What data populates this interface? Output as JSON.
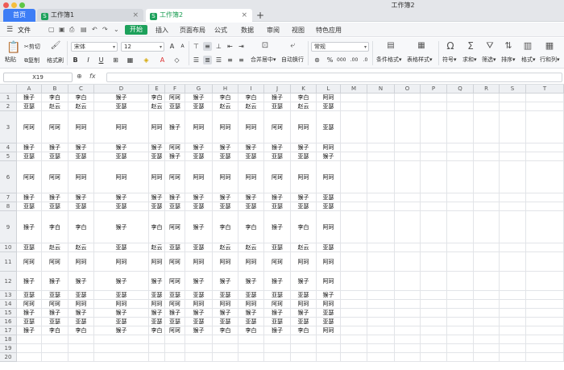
{
  "window": {
    "title": "工作簿2",
    "tabs": [
      {
        "label": "首页"
      },
      {
        "label": "工作簿1"
      },
      {
        "label": "工作簿2"
      }
    ],
    "new_tab": "+"
  },
  "menu": {
    "file": "文件",
    "start": "开始",
    "items": [
      "插入",
      "页面布局",
      "公式",
      "数据",
      "审阅",
      "视图",
      "特色应用"
    ]
  },
  "ribbon": {
    "paste": "粘贴",
    "cut": "剪切",
    "copy": "复制",
    "format_painter": "格式刷",
    "font": "宋体",
    "font_size": "12",
    "bold": "B",
    "italic": "I",
    "underline": "U",
    "merge": "合并居中",
    "wrap": "自动换行",
    "number_format": "常规",
    "cond_format": "条件格式",
    "table_style": "表格样式",
    "symbol": "符号",
    "sum": "求和",
    "filter": "筛选",
    "sort": "排序",
    "format": "格式",
    "rows_cols": "行和列"
  },
  "formula_bar": {
    "name_box": "X19",
    "fx": "fx",
    "value": ""
  },
  "sheet": {
    "columns": [
      "A",
      "B",
      "C",
      "D",
      "E",
      "F",
      "G",
      "H",
      "I",
      "J",
      "K",
      "L",
      "M",
      "N",
      "O",
      "P",
      "Q",
      "R",
      "S",
      "T"
    ],
    "row_numbers": [
      "1",
      "2",
      "3",
      "4",
      "5",
      "6",
      "7",
      "8",
      "9",
      "10",
      "11",
      "12",
      "13",
      "14",
      "15",
      "16",
      "17",
      "18",
      "19",
      "20"
    ],
    "rows": [
      [
        "猴子",
        "李白",
        "李白",
        "猴子",
        "李白",
        "阿珂",
        "猴子",
        "李白",
        "李白",
        "猴子",
        "李白",
        "阿珂"
      ],
      [
        "亚瑟",
        "赵云",
        "赵云",
        "亚瑟",
        "赵云",
        "亚瑟",
        "亚瑟",
        "赵云",
        "赵云",
        "亚瑟",
        "赵云",
        "亚瑟"
      ],
      [
        "阿珂",
        "阿珂",
        "阿珂",
        "阿珂",
        "阿珂",
        "猴子",
        "阿珂",
        "阿珂",
        "阿珂",
        "阿珂",
        "阿珂",
        "亚瑟"
      ],
      [
        "猴子",
        "猴子",
        "猴子",
        "猴子",
        "猴子",
        "阿珂",
        "猴子",
        "猴子",
        "猴子",
        "猴子",
        "猴子",
        "阿珂"
      ],
      [
        "亚瑟",
        "亚瑟",
        "亚瑟",
        "亚瑟",
        "亚瑟",
        "猴子",
        "亚瑟",
        "亚瑟",
        "亚瑟",
        "亚瑟",
        "亚瑟",
        "猴子"
      ],
      [
        "阿珂",
        "阿珂",
        "阿珂",
        "阿珂",
        "阿珂",
        "阿珂",
        "阿珂",
        "阿珂",
        "阿珂",
        "阿珂",
        "阿珂",
        "阿珂"
      ],
      [
        "猴子",
        "猴子",
        "猴子",
        "猴子",
        "猴子",
        "猴子",
        "猴子",
        "猴子",
        "猴子",
        "猴子",
        "猴子",
        "亚瑟"
      ],
      [
        "亚瑟",
        "亚瑟",
        "亚瑟",
        "亚瑟",
        "亚瑟",
        "亚瑟",
        "亚瑟",
        "亚瑟",
        "亚瑟",
        "亚瑟",
        "亚瑟",
        "亚瑟"
      ],
      [
        "猴子",
        "李白",
        "李白",
        "猴子",
        "李白",
        "阿珂",
        "猴子",
        "李白",
        "李白",
        "猴子",
        "李白",
        "阿珂"
      ],
      [
        "亚瑟",
        "赵云",
        "赵云",
        "亚瑟",
        "赵云",
        "亚瑟",
        "亚瑟",
        "赵云",
        "赵云",
        "亚瑟",
        "赵云",
        "亚瑟"
      ],
      [
        "阿珂",
        "阿珂",
        "阿珂",
        "阿珂",
        "阿珂",
        "阿珂",
        "阿珂",
        "阿珂",
        "阿珂",
        "阿珂",
        "阿珂",
        "阿珂"
      ],
      [
        "猴子",
        "猴子",
        "猴子",
        "猴子",
        "猴子",
        "阿珂",
        "猴子",
        "猴子",
        "猴子",
        "猴子",
        "猴子",
        "阿珂"
      ],
      [
        "亚瑟",
        "亚瑟",
        "亚瑟",
        "亚瑟",
        "亚瑟",
        "亚瑟",
        "亚瑟",
        "亚瑟",
        "亚瑟",
        "亚瑟",
        "亚瑟",
        "猴子"
      ],
      [
        "阿珂",
        "阿珂",
        "阿珂",
        "阿珂",
        "阿珂",
        "阿珂",
        "阿珂",
        "阿珂",
        "阿珂",
        "阿珂",
        "阿珂",
        "阿珂"
      ],
      [
        "猴子",
        "猴子",
        "猴子",
        "猴子",
        "猴子",
        "猴子",
        "猴子",
        "猴子",
        "猴子",
        "猴子",
        "猴子",
        "亚瑟"
      ],
      [
        "亚瑟",
        "亚瑟",
        "亚瑟",
        "亚瑟",
        "亚瑟",
        "亚瑟",
        "亚瑟",
        "亚瑟",
        "亚瑟",
        "亚瑟",
        "亚瑟",
        "亚瑟"
      ],
      [
        "猴子",
        "李白",
        "李白",
        "猴子",
        "李白",
        "阿珂",
        "猴子",
        "李白",
        "李白",
        "猴子",
        "李白",
        "阿珂"
      ],
      [
        "",
        "",
        "",
        "",
        "",
        "",
        "",
        "",
        "",
        "",
        "",
        ""
      ],
      [
        "",
        "",
        "",
        "",
        "",
        "",
        "",
        "",
        "",
        "",
        "",
        ""
      ],
      [
        "",
        "",
        "",
        "",
        "",
        "",
        "",
        "",
        "",
        "",
        "",
        ""
      ]
    ]
  },
  "colors": {
    "accent_green": "#1da15b",
    "home_tab_blue": "#3d7df6"
  }
}
